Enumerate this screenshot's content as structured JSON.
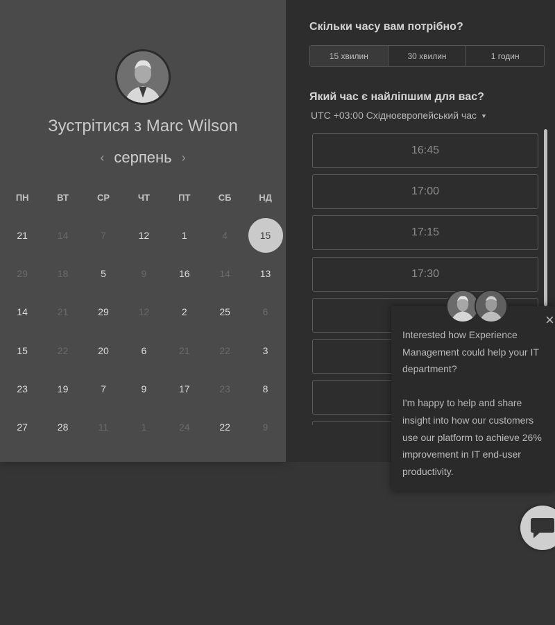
{
  "scheduler": {
    "title": "Зустрітися з Marc Wilson",
    "month": "серпень",
    "prev_icon": "chevron-left-icon",
    "next_icon": "chevron-right-icon",
    "weekdays": [
      "ПН",
      "ВТ",
      "СР",
      "ЧТ",
      "ПТ",
      "СБ",
      "НД"
    ],
    "calendar": [
      [
        {
          "d": "21",
          "on": true
        },
        {
          "d": "14",
          "on": false
        },
        {
          "d": "7",
          "on": false
        },
        {
          "d": "12",
          "on": true
        },
        {
          "d": "1",
          "on": true
        },
        {
          "d": "4",
          "on": false
        },
        {
          "d": "15",
          "on": true,
          "selected": true
        }
      ],
      [
        {
          "d": "29",
          "on": false
        },
        {
          "d": "18",
          "on": false
        },
        {
          "d": "5",
          "on": true
        },
        {
          "d": "9",
          "on": false
        },
        {
          "d": "16",
          "on": true
        },
        {
          "d": "14",
          "on": false
        },
        {
          "d": "13",
          "on": true
        }
      ],
      [
        {
          "d": "14",
          "on": true
        },
        {
          "d": "21",
          "on": false
        },
        {
          "d": "29",
          "on": true
        },
        {
          "d": "12",
          "on": false
        },
        {
          "d": "2",
          "on": true
        },
        {
          "d": "25",
          "on": true
        },
        {
          "d": "6",
          "on": false
        }
      ],
      [
        {
          "d": "15",
          "on": true
        },
        {
          "d": "22",
          "on": false
        },
        {
          "d": "20",
          "on": true
        },
        {
          "d": "6",
          "on": true
        },
        {
          "d": "21",
          "on": false
        },
        {
          "d": "22",
          "on": false
        },
        {
          "d": "3",
          "on": true
        }
      ],
      [
        {
          "d": "23",
          "on": true
        },
        {
          "d": "19",
          "on": true
        },
        {
          "d": "7",
          "on": true
        },
        {
          "d": "9",
          "on": true
        },
        {
          "d": "17",
          "on": true
        },
        {
          "d": "23",
          "on": false
        },
        {
          "d": "8",
          "on": true
        }
      ],
      [
        {
          "d": "27",
          "on": true
        },
        {
          "d": "28",
          "on": true
        },
        {
          "d": "11",
          "on": false
        },
        {
          "d": "1",
          "on": false
        },
        {
          "d": "24",
          "on": false
        },
        {
          "d": "22",
          "on": true
        },
        {
          "d": "9",
          "on": false
        }
      ]
    ]
  },
  "booking": {
    "duration_title": "Скільки часу вам потрібно?",
    "durations": [
      "15 хвилин",
      "30 хвилин",
      "1 годин"
    ],
    "time_title": "Який час є найліпшим для вас?",
    "timezone": "UTC +03:00 Східноєвропейський час",
    "slots": [
      "16:45",
      "17:00",
      "17:15",
      "17:30",
      "",
      "",
      "",
      ""
    ]
  },
  "chat": {
    "message": "Interested how Experience Management could help your IT department?\n\nI'm happy to help and share insight into how our customers use our platform to achieve 26% improvement in IT end-user productivity.",
    "close_symbol": "×",
    "launcher_icon": "chat-bubble-icon"
  }
}
